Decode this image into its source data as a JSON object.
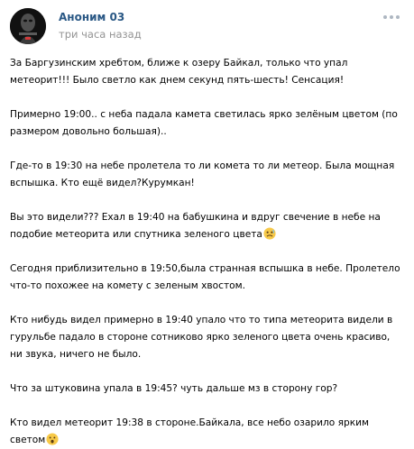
{
  "post": {
    "author": "Аноним 03",
    "time": "три часа назад",
    "paragraphs": [
      {
        "text": "За Баргузинским хребтом, ближе к озеру Байкал, только что упал метеорит!!! Было светло как днем секунд пять-шесть! Сенсация!",
        "emoji": ""
      },
      {
        "text": "Примерно 19:00.. с неба падала камета светилась ярко зелёным цветом (по размером довольно большая)..",
        "emoji": ""
      },
      {
        "text": "Где-то в 19:30 на небе пролетела то ли комета то ли метеор. Была мощная вспышка. Кто ещё видел?Курумкан!",
        "emoji": ""
      },
      {
        "text": "Вы это видели??? Ехал в 19:40 на бабушкина и вдруг свечение в небе на подобие метеорита или спутника зеленого цвета",
        "emoji": "scared-face-emoji"
      },
      {
        "text": "Сегодня приблизительно в 19:50,была странная вспышка в небе. Пролетело что-то похожее на комету с зеленым хвостом.",
        "emoji": ""
      },
      {
        "text": "Кто нибудь видел примерно в 19:40 упало что то типа метеорита видели в гурульбе падало в стороне сотниково ярко зеленого цвета очень красиво, ни звука, ничего не было.",
        "emoji": ""
      },
      {
        "text": "Что за штуковина упала в 19:45? чуть дальше мз в сторону гор?",
        "emoji": ""
      },
      {
        "text": "Кто видел метеорит 19:38 в стороне.Байкала, все небо озарило ярким светом",
        "emoji": "astonished-face-emoji"
      }
    ]
  },
  "colors": {
    "author_link": "#2a5885",
    "meta_text": "#939393",
    "menu_dots": "#aeb7c2",
    "emoji_face": "#f7c948"
  },
  "icons": {
    "avatar": "dark-portrait-avatar",
    "menu": "more-options-icon"
  }
}
